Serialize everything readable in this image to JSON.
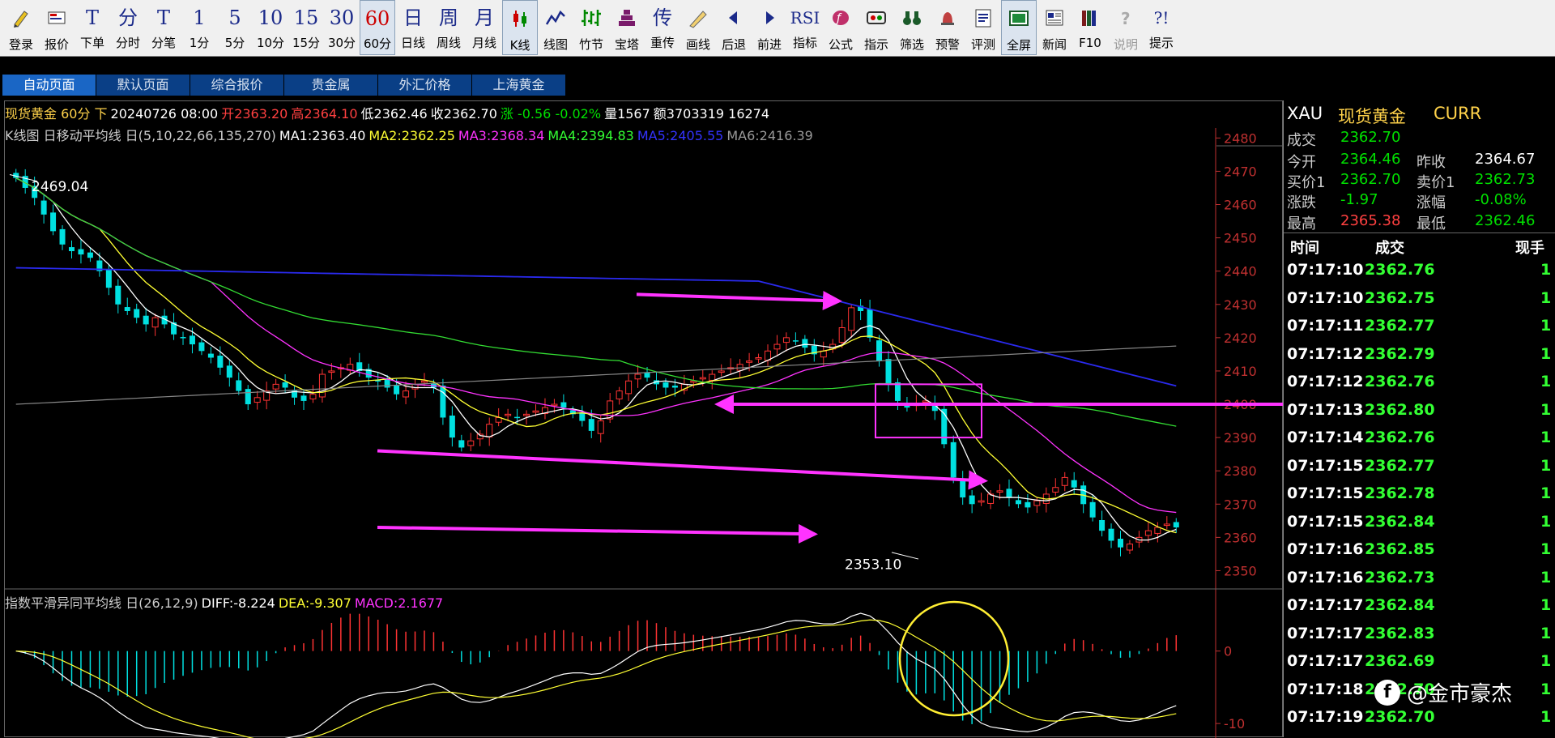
{
  "toolbar": [
    {
      "glyph": "pencil-icon",
      "label": "登录"
    },
    {
      "glyph": "quote-icon",
      "label": "报价"
    },
    {
      "text": "T",
      "label": "下单"
    },
    {
      "text": "分",
      "label": "分时"
    },
    {
      "text": "T",
      "label": "分笔"
    },
    {
      "text": "1",
      "label": "1分"
    },
    {
      "text": "5",
      "label": "5分"
    },
    {
      "text": "10",
      "label": "10分"
    },
    {
      "text": "15",
      "label": "15分"
    },
    {
      "text": "30",
      "label": "30分"
    },
    {
      "text": "60",
      "label": "60分",
      "active": true,
      "red": true
    },
    {
      "text": "日",
      "label": "日线"
    },
    {
      "text": "周",
      "label": "周线"
    },
    {
      "text": "月",
      "label": "月线"
    },
    {
      "glyph": "candle-icon",
      "label": "K线",
      "active": true
    },
    {
      "glyph": "line-chart-icon",
      "label": "线图"
    },
    {
      "glyph": "bamboo-icon",
      "label": "竹节"
    },
    {
      "glyph": "tower-icon",
      "label": "宝塔"
    },
    {
      "text": "传",
      "label": "重传"
    },
    {
      "glyph": "draw-line-icon",
      "label": "画线"
    },
    {
      "glyph": "back-arrow-icon",
      "label": "后退"
    },
    {
      "glyph": "forward-arrow-icon",
      "label": "前进"
    },
    {
      "text": "RSI",
      "label": "指标",
      "small": true
    },
    {
      "glyph": "formula-icon",
      "label": "公式"
    },
    {
      "glyph": "indicator-icon",
      "label": "指示"
    },
    {
      "glyph": "binoculars-icon",
      "label": "筛选"
    },
    {
      "glyph": "alarm-icon",
      "label": "预警"
    },
    {
      "glyph": "evaluate-icon",
      "label": "评测"
    },
    {
      "glyph": "fullscreen-icon",
      "label": "全屏",
      "active": true
    },
    {
      "glyph": "news-icon",
      "label": "新闻"
    },
    {
      "glyph": "books-icon",
      "label": "F10"
    },
    {
      "glyph": "help-icon",
      "label": "说明",
      "disabled": true
    },
    {
      "text": "?!",
      "label": "提示",
      "small": true
    }
  ],
  "tabs": [
    "自动页面",
    "默认页面",
    "综合报价",
    "贵金属",
    "外汇价格",
    "上海黄金"
  ],
  "info": [
    {
      "t": "现货黄金 60分 下",
      "c": "#ffd24a"
    },
    {
      "t": "20240726 08:00",
      "c": "#ffffff"
    },
    {
      "t": "开2363.20",
      "c": "#ff4040"
    },
    {
      "t": "高2364.10",
      "c": "#ff4040"
    },
    {
      "t": "低2362.46",
      "c": "#ffffff"
    },
    {
      "t": "收2362.70",
      "c": "#ffffff"
    },
    {
      "t": "涨 -0.56 -0.02%",
      "c": "#00e000"
    },
    {
      "t": "量1567",
      "c": "#ffffff"
    },
    {
      "t": "额3703319 16274",
      "c": "#ffffff"
    }
  ],
  "ma_bar": [
    {
      "t": "K线图 日移动平均线 日(5,10,22,66,135,270)",
      "c": "#cccccc"
    },
    {
      "t": "MA1:2363.40",
      "c": "#ffffff"
    },
    {
      "t": "MA2:2362.25",
      "c": "#ffff33"
    },
    {
      "t": "MA3:2368.34",
      "c": "#ff33ff"
    },
    {
      "t": "MA4:2394.83",
      "c": "#33ff33"
    },
    {
      "t": "MA5:2405.55",
      "c": "#3333ff"
    },
    {
      "t": "MA6:2416.39",
      "c": "#999999"
    }
  ],
  "macd_bar": [
    {
      "t": "指数平滑异同平均线 日(26,12,9)",
      "c": "#cccccc"
    },
    {
      "t": "DIFF:-8.224",
      "c": "#ffffff"
    },
    {
      "t": "DEA:-9.307",
      "c": "#ffff33"
    },
    {
      "t": "MACD:2.1677",
      "c": "#ff33ff"
    }
  ],
  "colors": {
    "up": "#ff3333",
    "down": "#00e0e0",
    "ma1": "#ffffff",
    "ma2": "#ffff33",
    "ma3": "#ff33ff",
    "ma4": "#33dd33",
    "ma5": "#2a2aee",
    "ma6": "#888888",
    "arrow": "#ff33ff",
    "circle": "#ffee33"
  },
  "chart_data": {
    "type": "candlestick",
    "symbol": "现货黄金",
    "period": "60分",
    "ylim": [
      2345,
      2483
    ],
    "yticks": [
      2350,
      2360,
      2370,
      2380,
      2390,
      2400,
      2410,
      2420,
      2430,
      2440,
      2450,
      2460,
      2470,
      2480
    ],
    "annotations": [
      {
        "text": "2469.04"
      },
      {
        "text": "2353.10"
      }
    ],
    "ohlc_anchors": [
      2468,
      2465,
      2462,
      2457,
      2452,
      2448,
      2446,
      2445,
      2444,
      2440,
      2435,
      2430,
      2428,
      2426,
      2424,
      2426,
      2424,
      2421,
      2420,
      2418,
      2416,
      2414,
      2411,
      2408,
      2404,
      2400,
      2402,
      2404,
      2406,
      2405,
      2402,
      2401,
      2403,
      2409,
      2410,
      2411,
      2412,
      2410,
      2408,
      2407,
      2405,
      2403,
      2404,
      2406,
      2407,
      2405,
      2396,
      2390,
      2387,
      2389,
      2391,
      2394,
      2396,
      2397,
      2396,
      2397,
      2398,
      2399,
      2400,
      2399,
      2397,
      2395,
      2392,
      2395,
      2401,
      2404,
      2407,
      2409,
      2408,
      2406,
      2405,
      2405,
      2406,
      2407,
      2408,
      2409,
      2410,
      2411,
      2412,
      2413,
      2414,
      2416,
      2418,
      2420,
      2419,
      2417,
      2415,
      2416,
      2418,
      2423,
      2429,
      2428,
      2420,
      2413,
      2406,
      2401,
      2399,
      2400,
      2401,
      2398,
      2388,
      2378,
      2372,
      2370,
      2371,
      2373,
      2374,
      2372,
      2370,
      2369,
      2371,
      2373,
      2375,
      2378,
      2375,
      2370,
      2366,
      2362,
      2359,
      2357,
      2358,
      2360,
      2362,
      2363,
      2364,
      2363
    ],
    "macd": {
      "range": [
        -12,
        6
      ],
      "ticks": [
        -10,
        0
      ]
    }
  },
  "quote": {
    "symbol": "XAU",
    "name": "现货黄金",
    "ccy": "CURR",
    "deal_label": "成交",
    "deal": "2362.70",
    "open_label": "今开",
    "open": "2364.46",
    "prev_label": "昨收",
    "prev": "2364.67",
    "bid_label": "买价1",
    "bid": "2362.70",
    "ask_label": "卖价1",
    "ask": "2362.73",
    "chg_label": "涨跌",
    "chg": "-1.97",
    "pct_label": "涨幅",
    "pct": "-0.08%",
    "high_label": "最高",
    "high": "2365.38",
    "low_label": "最低",
    "low": "2362.46",
    "col_time": "时间",
    "col_deal": "成交",
    "col_vol": "现手"
  },
  "ticks": [
    {
      "time": "07:17:10",
      "price": "2362.76",
      "vol": "1"
    },
    {
      "time": "07:17:10",
      "price": "2362.75",
      "vol": "1"
    },
    {
      "time": "07:17:11",
      "price": "2362.77",
      "vol": "1"
    },
    {
      "time": "07:17:12",
      "price": "2362.79",
      "vol": "1"
    },
    {
      "time": "07:17:12",
      "price": "2362.76",
      "vol": "1"
    },
    {
      "time": "07:17:13",
      "price": "2362.80",
      "vol": "1"
    },
    {
      "time": "07:17:14",
      "price": "2362.76",
      "vol": "1"
    },
    {
      "time": "07:17:15",
      "price": "2362.77",
      "vol": "1"
    },
    {
      "time": "07:17:15",
      "price": "2362.78",
      "vol": "1"
    },
    {
      "time": "07:17:15",
      "price": "2362.84",
      "vol": "1"
    },
    {
      "time": "07:17:16",
      "price": "2362.85",
      "vol": "1"
    },
    {
      "time": "07:17:16",
      "price": "2362.73",
      "vol": "1"
    },
    {
      "time": "07:17:17",
      "price": "2362.84",
      "vol": "1"
    },
    {
      "time": "07:17:17",
      "price": "2362.83",
      "vol": "1"
    },
    {
      "time": "07:17:17",
      "price": "2362.69",
      "vol": "1"
    },
    {
      "time": "07:17:18",
      "price": "2362.70",
      "vol": "1"
    },
    {
      "time": "07:17:19",
      "price": "2362.70",
      "vol": "1"
    }
  ],
  "watermark": "@金市豪杰"
}
